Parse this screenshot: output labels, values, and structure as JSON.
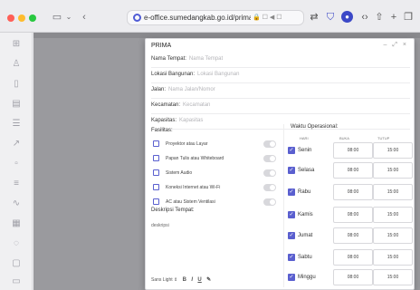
{
  "browser": {
    "url": "e-office.sumedangkab.go.id/prima/listin",
    "url_status_icons": "🔒 ☐ ◀ ☐"
  },
  "modal": {
    "title": "PRIMA",
    "controls": "– ⤢ ×",
    "fields": [
      {
        "label": "Nama Tempat:",
        "placeholder": "Nama Tempat"
      },
      {
        "label": "Lokasi Bangunan:",
        "placeholder": "Lokasi Bangunan"
      },
      {
        "label": "Jalan:",
        "placeholder": "Nama Jalan/Nomor"
      },
      {
        "label": "Kecamatan:",
        "placeholder": "Kecamatan"
      },
      {
        "label": "Kapasitas:",
        "placeholder": "Kapasitas"
      }
    ],
    "fasilitas": {
      "title": "Fasilitas:",
      "items": [
        {
          "label": "Proyektor atau Layar",
          "enabled": false
        },
        {
          "label": "Papan Tulis atau Whiteboard",
          "enabled": false
        },
        {
          "label": "Sistem Audio",
          "enabled": false
        },
        {
          "label": "Koneksi Internet atau Wi-Fi",
          "enabled": false
        },
        {
          "label": "AC atau Sistem Ventilasi",
          "enabled": false
        }
      ]
    },
    "deskripsi": {
      "title": "Deskripsi Tempat:",
      "text": "deskripsi",
      "editor_label": "Sans Light",
      "editor_tools": [
        "B",
        "I",
        "U",
        "✎"
      ]
    },
    "waktu": {
      "title": "Waktu Operasional:",
      "headers": [
        "HARI",
        "BUKA",
        "TUTUP"
      ],
      "days": [
        {
          "name": "Senin",
          "open": "08:00",
          "close": "15:00",
          "checked": true
        },
        {
          "name": "Selasa",
          "open": "08:00",
          "close": "15:00",
          "checked": true
        },
        {
          "name": "Rabu",
          "open": "08:00",
          "close": "15:00",
          "checked": true
        },
        {
          "name": "Kamis",
          "open": "08:00",
          "close": "15:00",
          "checked": true
        },
        {
          "name": "Jumat",
          "open": "08:00",
          "close": "15:00",
          "checked": true
        },
        {
          "name": "Sabtu",
          "open": "08:00",
          "close": "15:00",
          "checked": true
        },
        {
          "name": "Minggu",
          "open": "08:00",
          "close": "15:00",
          "checked": true
        }
      ]
    }
  },
  "colors": {
    "accent": "#5a5fcf",
    "toolbar": "#ececef",
    "page_backdrop": "#9a9a9e"
  }
}
